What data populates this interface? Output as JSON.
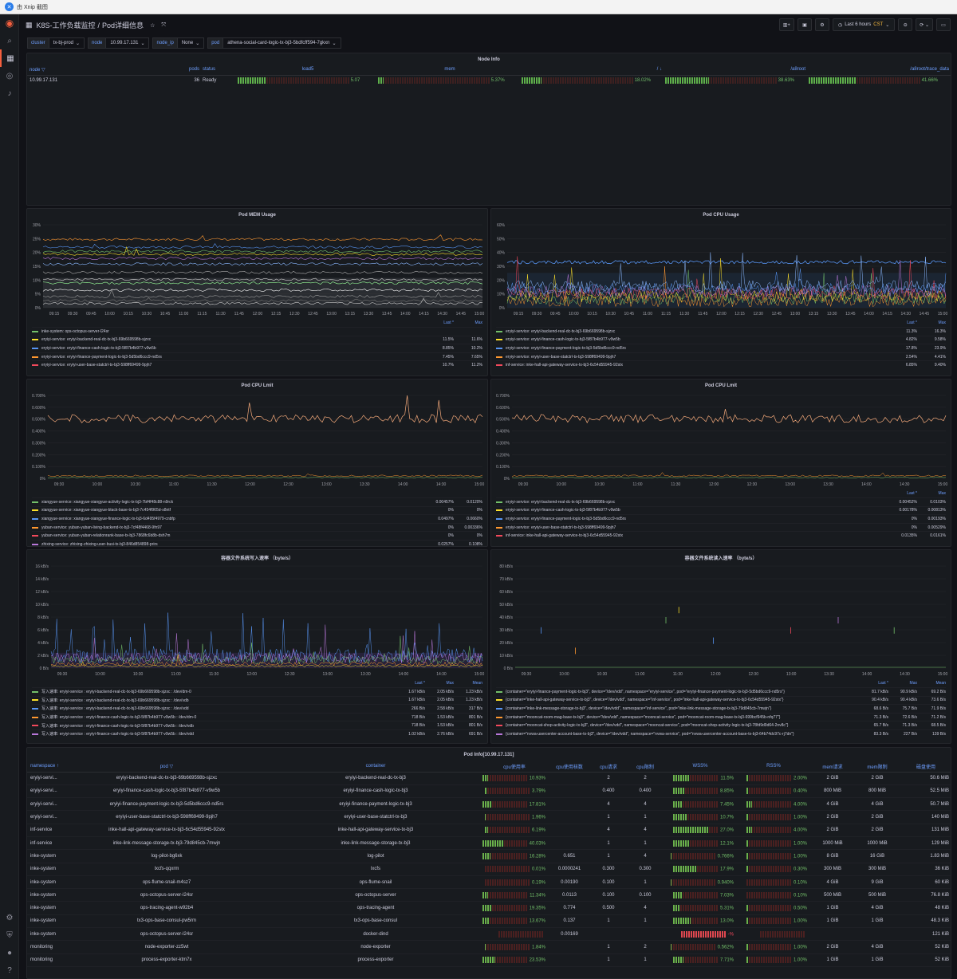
{
  "browser": {
    "title": "由 Xnip 截图"
  },
  "header": {
    "breadcrumb": "K8S-工作负载监控",
    "page": "Pod详细信息",
    "time_range": "Last 6 hours",
    "timezone": "CST"
  },
  "vars": [
    {
      "label": "cluster",
      "value": "tx-bj-prod"
    },
    {
      "label": "node",
      "value": "10.99.17.131"
    },
    {
      "label": "node_ip",
      "value": "None"
    },
    {
      "label": "pod",
      "value": "athena-social-card-logic-tx-bj3-5bdfcff594-7gkxn"
    }
  ],
  "node_info": {
    "title": "Node Info",
    "headers": [
      "node",
      "pods",
      "status",
      "load5",
      "mem",
      "/",
      "/a8root",
      "/a8root/trace_data"
    ],
    "row": {
      "node": "10.99.17.131",
      "pods": "36",
      "status": "Ready",
      "load5": "5.07",
      "load5_frac": 0.25,
      "mem": "5.37%",
      "mem_frac": 0.05,
      "root": "18.02%",
      "root_frac": 0.18,
      "a8root": "38.63%",
      "a8root_frac": 0.39,
      "trace": "41.66%",
      "trace_frac": 0.42
    }
  },
  "mem_panel": {
    "title": "Pod MEM Usage",
    "yticks": [
      "30%",
      "25%",
      "20%",
      "15%",
      "10%",
      "5%",
      "0%"
    ],
    "legend_head": [
      "Last *",
      "Max"
    ],
    "legend": [
      {
        "name": "inke-system: ops-octopus-server-l24sr",
        "last": "",
        "max": "",
        "color": "#73bf69"
      },
      {
        "name": "eryiyi-service: eryiyi-backend-real-dc-tx-bj3-69b669598b-sjzxc",
        "last": "11.5%",
        "max": "11.6%",
        "color": "#fade2a"
      },
      {
        "name": "eryiyi-service: eryiyi-finance-cash-logic-tx-bj3-5f87b4b977-v9w5b",
        "last": "8.85%",
        "max": "10.2%",
        "color": "#5794f2"
      },
      {
        "name": "eryiyi-service: eryiyi-finance-payment-logic-tx-bj3-5d5bd6ccc9-nd5rs",
        "last": "7.45%",
        "max": "7.65%",
        "color": "#ff9830"
      },
      {
        "name": "eryiyi-service: eryiyi-user-base-statctrl-tx-bj3-598ff69499-9pjh7",
        "last": "10.7%",
        "max": "11.2%",
        "color": "#f2495c"
      }
    ]
  },
  "cpu_panel": {
    "title": "Pod CPU Usage",
    "yticks": [
      "60%",
      "50%",
      "40%",
      "30%",
      "20%",
      "10%",
      "0%"
    ],
    "legend_head": [
      "Last *",
      "Max"
    ],
    "legend": [
      {
        "name": "eryiyi-service: eryiyi-backend-real-dc-tx-bj3-69b669598b-sjzxc",
        "last": "11.3%",
        "max": "16.3%",
        "color": "#73bf69"
      },
      {
        "name": "eryiyi-service: eryiyi-finance-cash-logic-tx-bj3-5f87b4b977-v9w5b",
        "last": "4.82%",
        "max": "9.58%",
        "color": "#fade2a"
      },
      {
        "name": "eryiyi-service: eryiyi-finance-payment-logic-tx-bj3-5d5bd6ccc9-nd5rs",
        "last": "17.8%",
        "max": "23.9%",
        "color": "#5794f2"
      },
      {
        "name": "eryiyi-service: eryiyi-user-base-statctrl-tx-bj3-598ff69499-9pjh7",
        "last": "2.54%",
        "max": "4.41%",
        "color": "#ff9830"
      },
      {
        "name": "inf-service: inke-hall-api-gateway-service-tx-bj3-6c54d55945-92stx",
        "last": "6.85%",
        "max": "9.40%",
        "color": "#f2495c"
      }
    ]
  },
  "limit_left": {
    "title": "Pod CPU Lmit",
    "yticks": [
      "0.700%",
      "0.600%",
      "0.500%",
      "0.400%",
      "0.300%",
      "0.200%",
      "0.100%",
      "0%"
    ],
    "legend": [
      {
        "name": "xiangyue-service: xiangyue-xiangyue-activity-logic-tx-bj3-7bf4f48c88-n9rck",
        "last": "0.00457%",
        "max": "0.0120%",
        "color": "#73bf69"
      },
      {
        "name": "xiangyue-service: xiangyue-xiangyue-black-base-tx-bj3-7c454f965d-s8ntf",
        "last": "0%",
        "max": "0%",
        "color": "#fade2a"
      },
      {
        "name": "xiangyue-service: xiangyue-xiangyue-finance-logic-tx-bj3-6d495f4979-cnbfp",
        "last": "0.0497%",
        "max": "0.0660%",
        "color": "#5794f2"
      },
      {
        "name": "yuban-service: yuban-yuban-living-backend-tx-bj3-7cf48f4468-9fn97",
        "last": "0%",
        "max": "0.00336%",
        "color": "#ff9830"
      },
      {
        "name": "yuban-service: yuban-yuban-relationrank-base-tx-bj3-7868fc6b8b-dsh7m",
        "last": "0%",
        "max": "0%",
        "color": "#f2495c"
      },
      {
        "name": "zhixing-service: zhixing-zhixing-user-busi-tx-bj3-846d854898-prirs",
        "last": "0.0257%",
        "max": "0.108%",
        "color": "#b877d9"
      }
    ]
  },
  "limit_right": {
    "title": "Pod CPU Lmit",
    "yticks": [
      "0.700%",
      "0.600%",
      "0.500%",
      "0.400%",
      "0.300%",
      "0.200%",
      "0.100%",
      "0%"
    ],
    "legend_head": [
      "Last *",
      "Max"
    ],
    "legend": [
      {
        "name": "eryiyi-service: eryiyi-backend-real-dc-tx-bj3-69b669598b-sjzxc",
        "last": "0.00452%",
        "max": "0.0103%",
        "color": "#73bf69"
      },
      {
        "name": "eryiyi-service: eryiyi-finance-cash-logic-tx-bj3-5f87b4b977-v9w5b",
        "last": "0.00178%",
        "max": "0.00813%",
        "color": "#fade2a"
      },
      {
        "name": "eryiyi-service: eryiyi-finance-payment-logic-tx-bj3-5d5bd6ccc9-nd5rs",
        "last": "0%",
        "max": "0.00193%",
        "color": "#5794f2"
      },
      {
        "name": "eryiyi-service: eryiyi-user-base-statctrl-tx-bj3-598ff69499-9pjh7",
        "last": "0%",
        "max": "0.00529%",
        "color": "#ff9830"
      },
      {
        "name": "inf-service: inke-hall-api-gateway-service-tx-bj3-6c54d55945-92stx",
        "last": "0.0135%",
        "max": "0.0161%",
        "color": "#f2495c"
      }
    ]
  },
  "write_panel": {
    "title": "容器文件系统写入速率 （byte/s）",
    "yticks": [
      "16 kB/s",
      "14 kB/s",
      "12 kB/s",
      "10 kB/s",
      "8 kB/s",
      "6 kB/s",
      "4 kB/s",
      "2 kB/s",
      "0 B/s"
    ],
    "legend_head": [
      "Last *",
      "Max",
      "Mean"
    ],
    "legend": [
      {
        "name": "写入速率: eryiyi-service : eryiyi-backend-real-dc-tx-bj3-69b669598b-sjzxc : /dev/dm-0",
        "last": "1.67 kB/s",
        "max": "2.05 kB/s",
        "mean": "1.23 kB/s",
        "color": "#73bf69"
      },
      {
        "name": "写入速率: eryiyi-service : eryiyi-backend-real-dc-tx-bj3-69b669598b-sjzxc : /dev/vdb",
        "last": "1.67 kB/s",
        "max": "2.05 kB/s",
        "mean": "1.23 kB/s",
        "color": "#fade2a"
      },
      {
        "name": "写入速率: eryiyi-service : eryiyi-backend-real-dc-tx-bj3-69b669598b-sjzxc : /dev/vdd",
        "last": "266 B/s",
        "max": "2.58 kB/s",
        "mean": "317 B/s",
        "color": "#5794f2"
      },
      {
        "name": "写入速率: eryiyi-service : eryiyi-finance-cash-logic-tx-bj3-5f87b4b977-v9w5b : /dev/dm-0",
        "last": "718 B/s",
        "max": "1.53 kB/s",
        "mean": "801 B/s",
        "color": "#ff9830"
      },
      {
        "name": "写入速率: eryiyi-service : eryiyi-finance-cash-logic-tx-bj3-5f87b4b977-v9w5b : /dev/vdb",
        "last": "718 B/s",
        "max": "1.53 kB/s",
        "mean": "801 B/s",
        "color": "#f2495c"
      },
      {
        "name": "写入速率: eryiyi-service : eryiyi-finance-cash-logic-tx-bj3-5f87b4b977-v9w5b : /dev/vdd",
        "last": "1.02 kB/s",
        "max": "2.76 kB/s",
        "mean": "691 B/s",
        "color": "#b877d9"
      }
    ]
  },
  "read_panel": {
    "title": "容器文件系统读入速率 （byte/s）",
    "yticks": [
      "80 kB/s",
      "70 kB/s",
      "60 kB/s",
      "50 kB/s",
      "40 kB/s",
      "30 kB/s",
      "20 kB/s",
      "10 kB/s",
      "0 B/s"
    ],
    "legend_head": [
      "Last *",
      "Max",
      "Mean"
    ],
    "legend": [
      {
        "name": "{container=\"eryiyi-finance-payment-logic-tx-bj3\", device=\"/dev/vdd\", namespace=\"eryiyi-service\", pod=\"eryiyi-finance-payment-logic-tx-bj3-5d5bd6ccc9-nd5rs\"}",
        "last": "81.7 kB/s",
        "max": "90.9 kB/s",
        "mean": "69.2 B/s",
        "color": "#73bf69"
      },
      {
        "name": "{container=\"inke-hall-api-gateway-service-tx-bj3\", device=\"/dev/vdd\", namespace=\"inf-service\", pod=\"inke-hall-api-gateway-service-tx-bj3-6c54d55945-92stx\"}",
        "last": "90.4 kB/s",
        "max": "90.4 kB/s",
        "mean": "73.6 B/s",
        "color": "#fade2a"
      },
      {
        "name": "{container=\"inke-link-message-storage-tx-bj3\", device=\"/dev/vdd\", namespace=\"inf-service\", pod=\"inke-link-message-storage-tx-bj3-79d845cb-7mwjn\"}",
        "last": "68.6 B/s",
        "max": "75.7 B/s",
        "mean": "71.9 B/s",
        "color": "#5794f2"
      },
      {
        "name": "{container=\"mooncat-room-mag-base-tx-bj3\", device=\"/dev/vdd\", namespace=\"mooncat-service\", pod=\"mooncat-room-mag-base-tx-bj3-699bcf945b-nfq77\"}",
        "last": "71.3 B/s",
        "max": "72.6 B/s",
        "mean": "71.2 B/s",
        "color": "#ff9830"
      },
      {
        "name": "{container=\"mooncat-shop-activity-logic-tx-bj3\", device=\"/dev/vdd\", namespace=\"mooncat-service\", pod=\"mooncat-shop-activity-logic-tx-bj3-78fd9d9d64-2nv8c\"}",
        "last": "65.7 B/s",
        "max": "71.3 B/s",
        "mean": "68.5 B/s",
        "color": "#f2495c"
      },
      {
        "name": "{container=\"nvwa-usercenter-account-base-tx-bj3\", device=\"/dev/vdd\", namespace=\"nvwa-service\", pod=\"nvwa-usercenter-account-base-tx-bj3-64b74dc97c-rj7dn\"}",
        "last": "83.3 B/s",
        "max": "227 B/s",
        "mean": "139 B/s",
        "color": "#b877d9"
      }
    ]
  },
  "xticks_a": [
    "09:15",
    "09:30",
    "09:45",
    "10:00",
    "10:15",
    "10:30",
    "10:45",
    "11:00",
    "11:15",
    "11:30",
    "11:45",
    "12:00",
    "12:15",
    "12:30",
    "12:45",
    "13:00",
    "13:15",
    "13:30",
    "13:45",
    "14:00",
    "14:15",
    "14:30",
    "14:45",
    "15:00"
  ],
  "xticks_b": [
    "09:30",
    "10:00",
    "10:30",
    "11:00",
    "11:30",
    "12:00",
    "12:30",
    "13:00",
    "13:30",
    "14:00",
    "14:30",
    "15:00"
  ],
  "pod_info": {
    "title": "Pod Info[10.99.17.131]",
    "headers": [
      "namespace ↑",
      "pod ▽",
      "container",
      "cpu使用率",
      "cpu使用核数",
      "cpu请求",
      "cpu限制",
      "WSS%",
      "RSS%",
      "mem请求",
      "mem限制",
      "磁盘使用"
    ],
    "rows": [
      {
        "ns": "eryiyi-servi...",
        "pod": "eryiyi-backend-real-dc-tx-bj3-69b669598b-sjzxc",
        "container": "eryiyi-backend-real-dc-tx-bj3",
        "cpu": "10.93%",
        "cpu_frac": 0.11,
        "cores": "",
        "req": "2",
        "lim": "2",
        "wss": "11.5%",
        "wss_frac": 0.12,
        "rss": "2.00%",
        "rss_frac": 0.02,
        "memreq": "2 GiB",
        "memlim": "2 GiB",
        "disk": "50.6 MiB"
      },
      {
        "ns": "eryiyi-servi...",
        "pod": "eryiyi-finance-cash-logic-tx-bj3-5f87b4b977-v9w5b",
        "container": "eryiyi-finance-cash-logic-tx-bj3",
        "cpu": "3.79%",
        "cpu_frac": 0.04,
        "cores": "",
        "req": "0.400",
        "lim": "0.400",
        "wss": "8.85%",
        "wss_frac": 0.09,
        "rss": "0.40%",
        "rss_frac": 0.01,
        "memreq": "800 MiB",
        "memlim": "800 MiB",
        "disk": "52.5 MiB"
      },
      {
        "ns": "eryiyi-servi...",
        "pod": "eryiyi-finance-payment-logic-tx-bj3-5d5bd6ccc9-nd5rs",
        "container": "eryiyi-finance-payment-logic-tx-bj3",
        "cpu": "17.81%",
        "cpu_frac": 0.18,
        "cores": "",
        "req": "4",
        "lim": "4",
        "wss": "7.45%",
        "wss_frac": 0.07,
        "rss": "4.00%",
        "rss_frac": 0.04,
        "memreq": "4 GiB",
        "memlim": "4 GiB",
        "disk": "50.7 MiB"
      },
      {
        "ns": "eryiyi-servi...",
        "pod": "eryiyi-user-base-statctrl-tx-bj3-598ff69499-9pjh7",
        "container": "eryiyi-user-base-statctrl-tx-bj3",
        "cpu": "1.96%",
        "cpu_frac": 0.02,
        "cores": "",
        "req": "1",
        "lim": "1",
        "wss": "10.7%",
        "wss_frac": 0.11,
        "rss": "1.00%",
        "rss_frac": 0.01,
        "memreq": "2 GiB",
        "memlim": "2 GiB",
        "disk": "140 MiB"
      },
      {
        "ns": "inf-service",
        "pod": "inke-hall-api-gateway-service-tx-bj3-6c54d55945-92stx",
        "container": "inke-hall-api-gateway-service-tx-bj3",
        "cpu": "6.19%",
        "cpu_frac": 0.06,
        "cores": "",
        "req": "4",
        "lim": "4",
        "wss": "27.0%",
        "wss_frac": 0.27,
        "rss": "4.00%",
        "rss_frac": 0.04,
        "memreq": "2 GiB",
        "memlim": "2 GiB",
        "disk": "131 MiB"
      },
      {
        "ns": "inf-service",
        "pod": "inke-link-message-storage-tx-bj3-79d845cb-7mwjn",
        "container": "inke-link-message-storage-tx-bj3",
        "cpu": "40.03%",
        "cpu_frac": 0.4,
        "cores": "",
        "req": "1",
        "lim": "1",
        "wss": "12.1%",
        "wss_frac": 0.12,
        "rss": "1.00%",
        "rss_frac": 0.01,
        "memreq": "1000 MiB",
        "memlim": "1000 MiB",
        "disk": "129 MiB"
      },
      {
        "ns": "inke-system",
        "pod": "log-pilot-bg6xk",
        "container": "log-pilot",
        "cpu": "16.28%",
        "cpu_frac": 0.16,
        "cores": "0.651",
        "req": "1",
        "lim": "4",
        "wss": "0.766%",
        "wss_frac": 0.01,
        "rss": "1.00%",
        "rss_frac": 0.01,
        "memreq": "8 GiB",
        "memlim": "16 GiB",
        "disk": "1.83 MiB"
      },
      {
        "ns": "inke-system",
        "pod": "lxcfs-qqxrm",
        "container": "lxcfs",
        "cpu": "0.01%",
        "cpu_frac": 0.0,
        "cores": "0.0000241",
        "req": "0.300",
        "lim": "0.300",
        "wss": "17.9%",
        "wss_frac": 0.18,
        "rss": "0.30%",
        "rss_frac": 0.01,
        "memreq": "300 MiB",
        "memlim": "300 MiB",
        "disk": "36 KiB"
      },
      {
        "ns": "inke-system",
        "pod": "ops-flume-snail-m4sz7",
        "container": "ops-flume-snail",
        "cpu": "0.19%",
        "cpu_frac": 0.0,
        "cores": "0.00190",
        "req": "0.100",
        "lim": "1",
        "wss": "0.940%",
        "wss_frac": 0.01,
        "rss": "0.10%",
        "rss_frac": 0.0,
        "memreq": "4 GiB",
        "memlim": "9 GiB",
        "disk": "60 KiB"
      },
      {
        "ns": "inke-system",
        "pod": "ops-octopus-server-l24sr",
        "container": "ops-octopus-server",
        "cpu": "11.34%",
        "cpu_frac": 0.11,
        "cores": "0.0113",
        "req": "0.100",
        "lim": "0.100",
        "wss": "7.03%",
        "wss_frac": 0.07,
        "rss": "0.10%",
        "rss_frac": 0.0,
        "memreq": "500 MiB",
        "memlim": "500 MiB",
        "disk": "76.8 KiB"
      },
      {
        "ns": "inke-system",
        "pod": "ops-tracing-agent-w92b4",
        "container": "ops-tracing-agent",
        "cpu": "19.35%",
        "cpu_frac": 0.19,
        "cores": "0.774",
        "req": "0.500",
        "lim": "4",
        "wss": "5.31%",
        "wss_frac": 0.05,
        "rss": "0.50%",
        "rss_frac": 0.01,
        "memreq": "1 GiB",
        "memlim": "4 GiB",
        "disk": "48 KiB"
      },
      {
        "ns": "inke-system",
        "pod": "tx3-ops-base-consul-pw5rm",
        "container": "tx3-ops-base-consul",
        "cpu": "13.67%",
        "cpu_frac": 0.14,
        "cores": "0.137",
        "req": "1",
        "lim": "1",
        "wss": "13.0%",
        "wss_frac": 0.13,
        "rss": "1.00%",
        "rss_frac": 0.01,
        "memreq": "1 GiB",
        "memlim": "1 GiB",
        "disk": "48.3 KiB"
      },
      {
        "ns": "inke-system",
        "pod": "ops-octopus-server-l24sr",
        "container": "docker-dind",
        "cpu": "",
        "cpu_frac": 0,
        "cores": "0.00169",
        "req": "",
        "lim": "",
        "wss": "-%",
        "wss_frac": 1.0,
        "rss": "",
        "rss_frac": 0,
        "memreq": "",
        "memlim": "",
        "disk": "121 KiB"
      },
      {
        "ns": "monitoring",
        "pod": "node-exporter-zz5wt",
        "container": "node-exporter",
        "cpu": "1.84%",
        "cpu_frac": 0.02,
        "cores": "",
        "req": "1",
        "lim": "2",
        "wss": "0.562%",
        "wss_frac": 0.01,
        "rss": "1.00%",
        "rss_frac": 0.01,
        "memreq": "2 GiB",
        "memlim": "4 GiB",
        "disk": "52 KiB"
      },
      {
        "ns": "monitoring",
        "pod": "process-exporter-ktm7x",
        "container": "process-exporter",
        "cpu": "23.53%",
        "cpu_frac": 0.24,
        "cores": "",
        "req": "1",
        "lim": "1",
        "wss": "7.71%",
        "wss_frac": 0.08,
        "rss": "1.00%",
        "rss_frac": 0.01,
        "memreq": "1 GiB",
        "memlim": "1 GiB",
        "disk": "52 KiB"
      }
    ]
  }
}
